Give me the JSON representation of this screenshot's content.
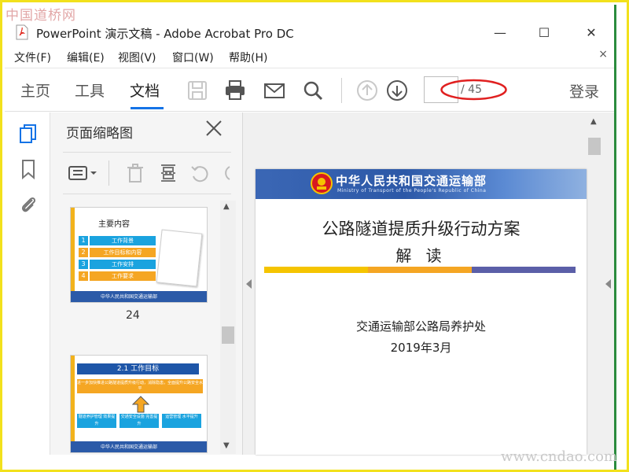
{
  "watermark": {
    "top": "中国道桥网",
    "bottom": "www.cndao.com"
  },
  "window": {
    "title": "PowerPoint 演示文稿 - Adobe Acrobat Pro DC",
    "minimize": "—",
    "maximize": "☐",
    "close": "✕"
  },
  "menu": {
    "items": [
      "文件(F)",
      "编辑(E)",
      "视图(V)",
      "窗口(W)",
      "帮助(H)"
    ],
    "close": "×"
  },
  "toolbar": {
    "tabs": [
      "主页",
      "工具",
      "文档"
    ],
    "active_tab": "文档",
    "current_page": "",
    "total_pages": "/ 45",
    "login": "登录",
    "accent": "#1473e6"
  },
  "thumbnails_panel": {
    "title": "页面缩略图",
    "thumbs": [
      {
        "page_label": "24",
        "title": "主要内容",
        "rows": [
          {
            "num": "1",
            "label": "工作背景",
            "color": "#1aa3df"
          },
          {
            "num": "2",
            "label": "工作目标和内容",
            "color": "#f5a623"
          },
          {
            "num": "3",
            "label": "工作安排",
            "color": "#1aa3df"
          },
          {
            "num": "4",
            "label": "工作要求",
            "color": "#f5a623"
          }
        ],
        "footer": "中华人民共和国交通运输部"
      },
      {
        "title": "2.1  工作目标",
        "orange_text": "进一步加快推进公路隧道提质升级行动，消除隐患，全面提升公路安全水平",
        "boxes": [
          "隧道养护管理 效果提升",
          "交通安全设施 完善提升",
          "运营管理 水平提升"
        ]
      }
    ]
  },
  "document": {
    "banner_cn": "中华人民共和国交通运输部",
    "banner_en": "Ministry of Transport of the People's Republic of China",
    "title": "公路隧道提质升级行动方案",
    "subtitle": "解 读",
    "org": "交通运输部公路局养护处",
    "date": "2019年3月",
    "stripe_colors": [
      "#f5c400",
      "#f5a623",
      "#5b5fa8"
    ]
  }
}
